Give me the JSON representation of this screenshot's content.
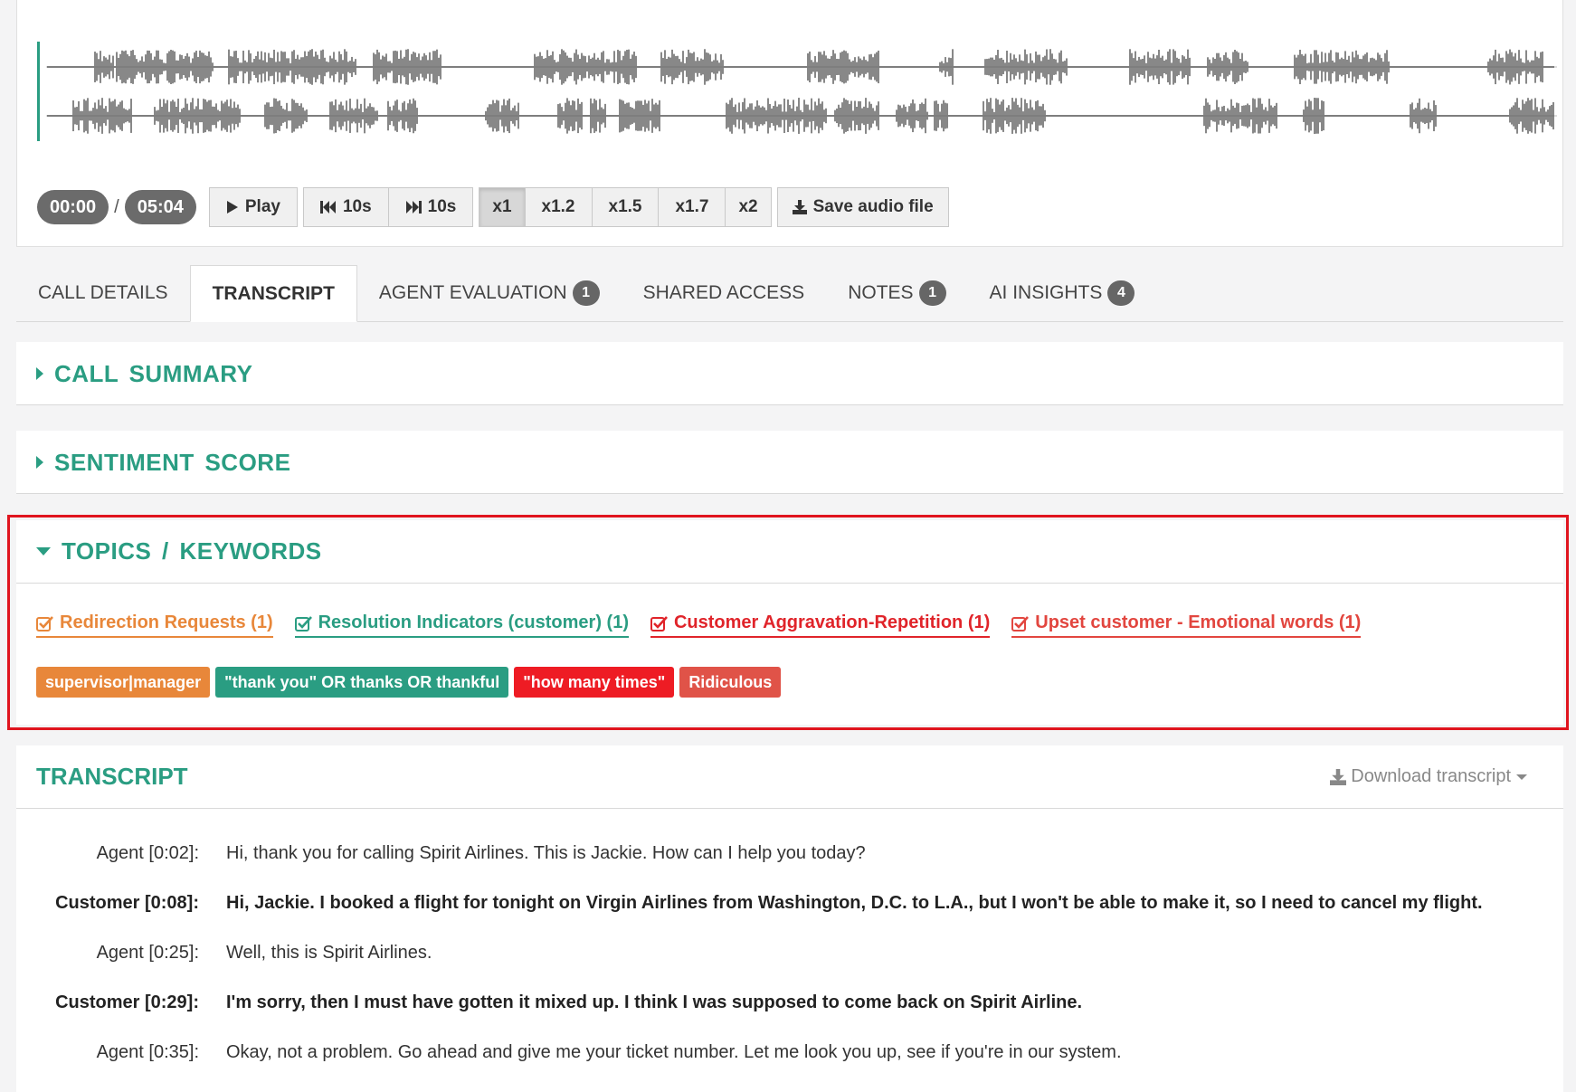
{
  "player": {
    "current_time": "00:00",
    "separator": "/",
    "duration": "05:04",
    "play_label": "Play",
    "rewind_label": "10s",
    "forward_label": "10s",
    "speeds": [
      {
        "label": "x1",
        "active": true
      },
      {
        "label": "x1.2",
        "active": false
      },
      {
        "label": "x1.5",
        "active": false
      },
      {
        "label": "x1.7",
        "active": false
      },
      {
        "label": "x2",
        "active": false
      }
    ],
    "save_label": "Save audio file",
    "waveform_color": "#555555",
    "cursor_color": "#2a9d82"
  },
  "tabs": [
    {
      "label": "CALL DETAILS",
      "badge": null,
      "active": false
    },
    {
      "label": "TRANSCRIPT",
      "badge": null,
      "active": true
    },
    {
      "label": "AGENT EVALUATION",
      "badge": "1",
      "active": false
    },
    {
      "label": "SHARED ACCESS",
      "badge": null,
      "active": false
    },
    {
      "label": "NOTES",
      "badge": "1",
      "active": false
    },
    {
      "label": "AI INSIGHTS",
      "badge": "4",
      "active": false
    }
  ],
  "sections": {
    "call_summary": "CALL SUMMARY",
    "sentiment_score": "SENTIMENT SCORE",
    "topics_keywords": "TOPICS / KEYWORDS"
  },
  "topics": [
    {
      "label": "Redirection Requests (1)",
      "color": "#e8873a"
    },
    {
      "label": "Resolution Indicators (customer) (1)",
      "color": "#2a9d82"
    },
    {
      "label": "Customer Aggravation-Repetition (1)",
      "color": "#e0242a"
    },
    {
      "label": "Upset customer - Emotional words (1)",
      "color": "#e2463f"
    }
  ],
  "keywords": [
    {
      "label": "supervisor|manager",
      "color": "#e8873a"
    },
    {
      "label": "\"thank you\" OR thanks OR thankful",
      "color": "#2a9d82"
    },
    {
      "label": "\"how many times\"",
      "color": "#ee1c24"
    },
    {
      "label": "Ridiculous",
      "color": "#e05348"
    }
  ],
  "transcript": {
    "title": "TRANSCRIPT",
    "download_label": "Download transcript",
    "lines": [
      {
        "speaker": "Agent [0:02]:",
        "text": "Hi, thank you for calling Spirit Airlines. This is Jackie. How can I help you today?",
        "role": "agent"
      },
      {
        "speaker": "Customer [0:08]:",
        "text": "Hi, Jackie. I booked a flight for tonight on Virgin Airlines from Washington, D.C. to L.A., but I won't be able to make it, so I need to cancel my flight.",
        "role": "customer"
      },
      {
        "speaker": "Agent [0:25]:",
        "text": "Well, this is Spirit Airlines.",
        "role": "agent"
      },
      {
        "speaker": "Customer [0:29]:",
        "text": "I'm sorry, then I must have gotten it mixed up. I think I was supposed to come back on Spirit Airline.",
        "role": "customer"
      },
      {
        "speaker": "Agent [0:35]:",
        "text": "Okay, not a problem. Go ahead and give me your ticket number. Let me look you up, see if you're in our system.",
        "role": "agent"
      }
    ]
  }
}
